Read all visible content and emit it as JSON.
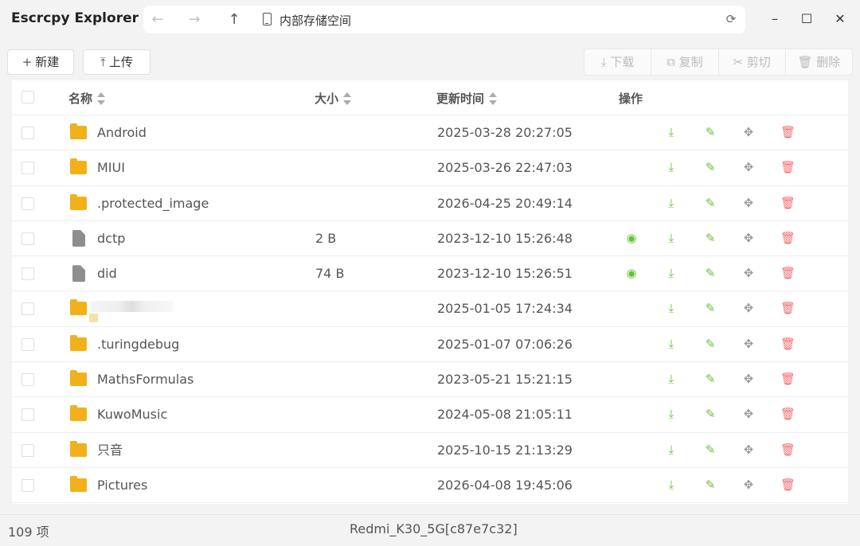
{
  "app": {
    "title": "Escrcpy Explorer"
  },
  "nav": {
    "back_icon": "←",
    "forward_icon": "→",
    "up_icon": "↑",
    "refresh_icon": "⟳"
  },
  "address": {
    "path": "内部存储空间"
  },
  "window": {
    "minimize": "–",
    "maximize": "☐",
    "close": "✕"
  },
  "toolbar": {
    "new_label": "新建",
    "upload_label": "上传",
    "download_label": "下载",
    "copy_label": "复制",
    "cut_label": "剪切",
    "delete_label": "删除"
  },
  "table": {
    "headers": {
      "name": "名称",
      "size": "大小",
      "updated": "更新时间",
      "actions": "操作"
    },
    "rows": [
      {
        "type": "folder",
        "name": "Android",
        "size": "",
        "updated": "2025-03-28 20:27:05",
        "preview": false
      },
      {
        "type": "folder",
        "name": "MIUI",
        "size": "",
        "updated": "2025-03-26 22:47:03",
        "preview": false
      },
      {
        "type": "folder",
        "name": ".protected_image",
        "size": "",
        "updated": "2026-04-25 20:49:14",
        "preview": false
      },
      {
        "type": "file",
        "name": "dctp",
        "size": "2 B",
        "updated": "2023-12-10 15:26:48",
        "preview": true
      },
      {
        "type": "file",
        "name": "did",
        "size": "74 B",
        "updated": "2023-12-10 15:26:51",
        "preview": true
      },
      {
        "type": "folder",
        "name": "",
        "size": "",
        "updated": "2025-01-05 17:24:34",
        "preview": false,
        "blurred": true
      },
      {
        "type": "folder",
        "name": ".turingdebug",
        "size": "",
        "updated": "2025-01-07 07:06:26",
        "preview": false
      },
      {
        "type": "folder",
        "name": "MathsFormulas",
        "size": "",
        "updated": "2023-05-21 15:21:15",
        "preview": false
      },
      {
        "type": "folder",
        "name": "KuwoMusic",
        "size": "",
        "updated": "2024-05-08 21:05:11",
        "preview": false
      },
      {
        "type": "folder",
        "name": "只音",
        "size": "",
        "updated": "2025-10-15 21:13:29",
        "preview": false
      },
      {
        "type": "folder",
        "name": "Pictures",
        "size": "",
        "updated": "2026-04-08 19:45:06",
        "preview": false
      }
    ]
  },
  "status": {
    "count": "109 项",
    "device": "Redmi_K30_5G[c87e7c32]"
  },
  "colors": {
    "folder": "#f2b11a",
    "action_green": "#67c23a",
    "action_red": "#f56c6c"
  }
}
